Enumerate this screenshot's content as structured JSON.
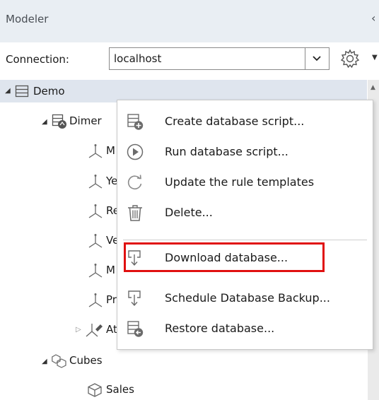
{
  "header": {
    "title": "Modeler"
  },
  "connection": {
    "label": "Connection:",
    "value": "localhost"
  },
  "tree": {
    "root": "Demo",
    "dimensions_label": "Dimer",
    "dimension_children": [
      "M",
      "Ye",
      "Re",
      "Ve",
      "M",
      "Pr"
    ],
    "attributes_label": "At",
    "cubes_label": "Cubes",
    "cube_children": [
      "Sales"
    ]
  },
  "context_menu": {
    "items": [
      {
        "label": "Create database script...",
        "icon": "create-script-icon"
      },
      {
        "label": "Run database script...",
        "icon": "run-icon"
      },
      {
        "label": "Update the rule templates",
        "icon": "refresh-icon"
      },
      {
        "label": "Delete...",
        "icon": "trash-icon"
      },
      {
        "label": "Download database...",
        "icon": "download-icon",
        "highlighted": true
      },
      {
        "label": "Schedule Database Backup...",
        "icon": "download-icon"
      },
      {
        "label": "Restore database...",
        "icon": "restore-icon"
      }
    ]
  },
  "colors": {
    "header_bg": "#e9eef3",
    "selected_row": "#dfe5ee",
    "highlight_border": "#e01010",
    "icon_gray": "#6b6b6b"
  }
}
